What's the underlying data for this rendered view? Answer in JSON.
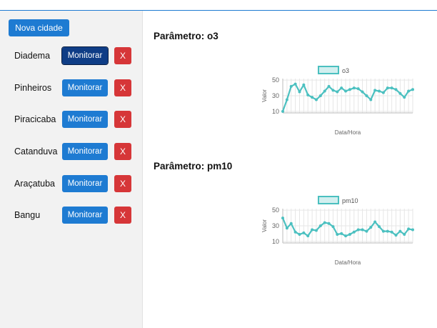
{
  "sidebar": {
    "new_city_label": "Nova cidade",
    "cities": [
      {
        "name": "Diadema",
        "monitor_label": "Monitorar",
        "remove_label": "X",
        "active": true
      },
      {
        "name": "Pinheiros",
        "monitor_label": "Monitorar",
        "remove_label": "X",
        "active": false
      },
      {
        "name": "Piracicaba",
        "monitor_label": "Monitorar",
        "remove_label": "X",
        "active": false
      },
      {
        "name": "Catanduva",
        "monitor_label": "Monitorar",
        "remove_label": "X",
        "active": false
      },
      {
        "name": "Araçatuba",
        "monitor_label": "Monitorar",
        "remove_label": "X",
        "active": false
      },
      {
        "name": "Bangu",
        "monitor_label": "Monitorar",
        "remove_label": "X",
        "active": false
      }
    ]
  },
  "colors": {
    "accent": "#1e7bd2",
    "active_button": "#0f3d86",
    "danger": "#d63638",
    "series": "#4bc0c0"
  },
  "main": {
    "panels": [
      {
        "title": "Parâmetro: o3"
      },
      {
        "title": "Parâmetro: pm10"
      }
    ]
  },
  "chart_data": [
    {
      "type": "line",
      "title": "",
      "xlabel": "Data/Hora",
      "ylabel": "Valor",
      "ylim": [
        8,
        52
      ],
      "yticks": [
        10,
        30,
        50
      ],
      "grid": true,
      "legend": "top-center",
      "series": [
        {
          "name": "o3",
          "color": "#4bc0c0",
          "values": [
            10,
            25,
            42,
            45,
            35,
            44,
            31,
            28,
            25,
            30,
            36,
            42,
            37,
            35,
            40,
            36,
            38,
            40,
            39,
            35,
            30,
            25,
            37,
            36,
            34,
            40,
            40,
            38,
            33,
            28,
            36,
            38
          ]
        }
      ]
    },
    {
      "type": "line",
      "title": "",
      "xlabel": "Data/Hora",
      "ylabel": "Valor",
      "ylim": [
        8,
        52
      ],
      "yticks": [
        10,
        30,
        50
      ],
      "grid": true,
      "legend": "top-center",
      "series": [
        {
          "name": "pm10",
          "color": "#4bc0c0",
          "values": [
            40,
            27,
            33,
            22,
            19,
            21,
            17,
            25,
            24,
            30,
            34,
            33,
            29,
            19,
            20,
            17,
            19,
            22,
            25,
            25,
            23,
            28,
            35,
            29,
            23,
            23,
            22,
            18,
            23,
            19,
            26,
            25
          ]
        }
      ]
    }
  ]
}
